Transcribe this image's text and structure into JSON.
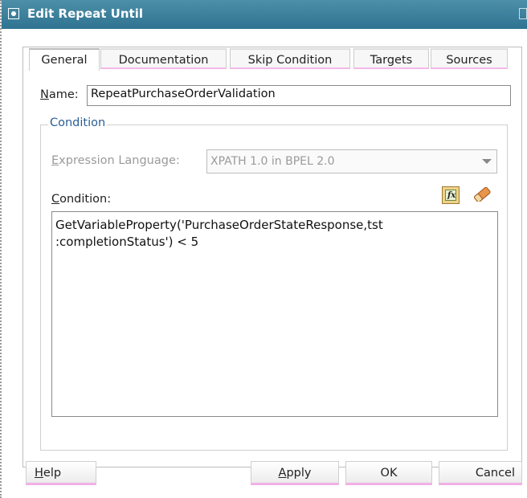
{
  "window": {
    "title": "Edit Repeat Until"
  },
  "tabs": [
    {
      "label": "General",
      "active": true
    },
    {
      "label": "Documentation",
      "active": false
    },
    {
      "label": "Skip Condition",
      "active": false
    },
    {
      "label": "Targets",
      "active": false
    },
    {
      "label": "Sources",
      "active": false
    }
  ],
  "name": {
    "label": "Name:",
    "mnemonic": "N",
    "value": "RepeatPurchaseOrderValidation"
  },
  "condition_group": {
    "legend": "Condition",
    "expression_language": {
      "label": "Expression Language:",
      "mnemonic": "E",
      "value": "XPATH 1.0 in BPEL 2.0"
    },
    "condition_label": "Condition:",
    "condition_mnemonic": "C",
    "condition_text": "GetVariableProperty('PurchaseOrderStateResponse,tst\n:completionStatus') < 5",
    "icons": [
      "expression-builder-icon",
      "eraser-icon"
    ]
  },
  "buttons": {
    "help": "Help",
    "apply": "Apply",
    "ok": "OK",
    "cancel": "Cancel"
  },
  "colors": {
    "titlebar": "#2f7391",
    "group_legend": "#2a5f94",
    "tab_accent": "#f3b8e8"
  }
}
